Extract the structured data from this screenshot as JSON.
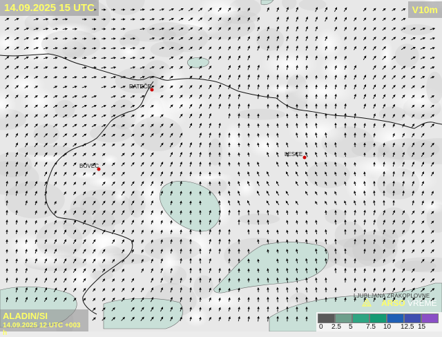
{
  "header": {
    "valid_time": "14.09.2025 15 UTC",
    "variable": "V10m"
  },
  "footer": {
    "model": "ALADIN/SI",
    "run_info": "14.09.2025 12 UTC +003 h"
  },
  "places": [
    {
      "name": "RATEČE"
    },
    {
      "name": "BOVEC"
    },
    {
      "name": "LESCE"
    }
  ],
  "legend": {
    "ticks": [
      "0",
      "2.5",
      "5",
      "7.5",
      "10",
      "12.5",
      "15"
    ],
    "colors": [
      "#5a5a5a",
      "#6e9f8c",
      "#2fa582",
      "#149a73",
      "#1f5fb5",
      "#3f4fb0",
      "#8a4fc6"
    ]
  },
  "branding": {
    "small_text": "LJUBLJANA ZRAKOPLOVNE",
    "brand": "ARSO",
    "brand2": "VREME"
  },
  "colors": {
    "accent": "#ffff66",
    "shade": "#c9e0d8",
    "arrow": "#000000",
    "border": "#111111",
    "city": "#cc0000"
  }
}
